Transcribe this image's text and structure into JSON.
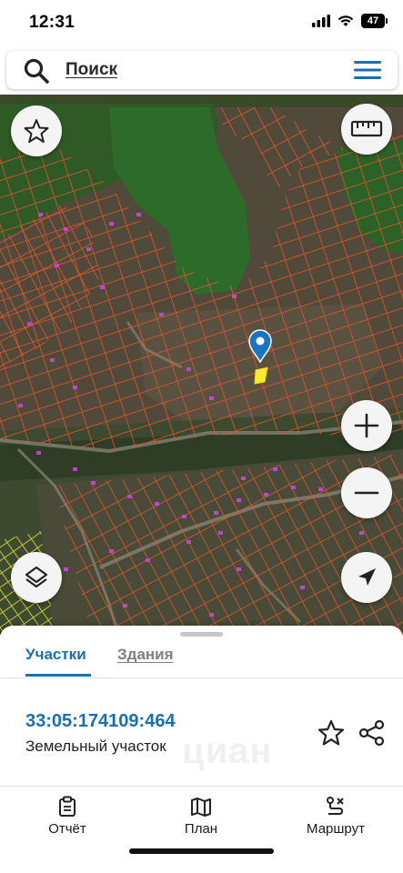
{
  "status_bar": {
    "time": "12:31",
    "battery": "47",
    "icons": [
      "signal-icon",
      "wifi-icon",
      "battery-icon"
    ]
  },
  "search": {
    "label": "Поиск",
    "icon": "search-icon",
    "menu_icon": "hamburger-menu-icon"
  },
  "map": {
    "controls": {
      "favorite": "star-icon",
      "ruler": "ruler-icon",
      "zoom_in": "plus-icon",
      "zoom_out": "minus-icon",
      "layers": "layers-icon",
      "locate": "navigation-arrow-icon"
    },
    "marker": "map-pin-icon",
    "colors": {
      "parcel_outline": "#e04a2c",
      "selected_parcel": "#f2ee2a",
      "marker": "#1a73c4",
      "building": "#c54bd1"
    }
  },
  "sheet": {
    "tabs": [
      {
        "label": "Участки",
        "active": true
      },
      {
        "label": "Здания",
        "active": false
      }
    ],
    "parcel": {
      "cadastral_number": "33:05:174109:464",
      "type": "Земельный участок"
    },
    "watermark": "циан"
  },
  "bottom_nav": [
    {
      "label": "Отчёт",
      "icon": "report-clipboard-icon"
    },
    {
      "label": "План",
      "icon": "map-plan-icon"
    },
    {
      "label": "Маршрут",
      "icon": "route-icon"
    }
  ],
  "colors": {
    "accent": "#1a6fb3",
    "inactive_tab": "#808080"
  }
}
